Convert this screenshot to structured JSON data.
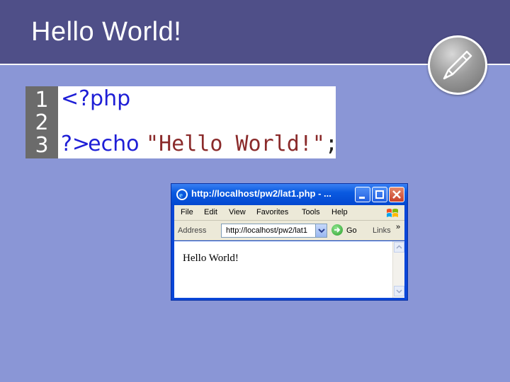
{
  "slide": {
    "title": "Hello World!"
  },
  "code": {
    "line_numbers": [
      "1",
      "2",
      "3"
    ],
    "line1": "<?php",
    "line2_keyword": "echo",
    "line2_string": "\"Hello World!\"",
    "line2_end": ";",
    "line3": "?>"
  },
  "browser": {
    "window_title": "http://localhost/pw2/lat1.php - ...",
    "menu": [
      "File",
      "Edit",
      "View",
      "Favorites",
      "Tools",
      "Help"
    ],
    "address_label": "Address",
    "address_value": "http://localhost/pw2/lat1",
    "go_label": "Go",
    "links_label": "Links",
    "links_chevron": "»",
    "page_text": "Hello World!"
  },
  "icons": {
    "pen": "pen-icon",
    "ie": "internet-explorer-icon",
    "windows": "windows-logo-icon"
  },
  "colors": {
    "background": "#8a96d6",
    "title_bar": "#4f4f88",
    "keyword": "#1e1ed6",
    "string": "#8a2a2a",
    "xp_title": "#0a5ae0"
  }
}
